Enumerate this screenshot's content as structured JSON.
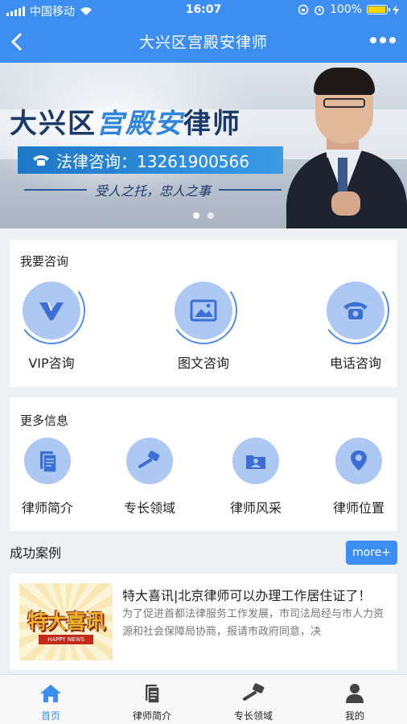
{
  "status_bar": {
    "carrier": "中国移动",
    "time": "16:07",
    "battery": "100%",
    "battery_level": 1.0
  },
  "header": {
    "title": "大兴区宫殿安律师",
    "back_icon": "back-arrow-icon",
    "more_icon": "more-dots-icon"
  },
  "banner": {
    "title_part1": "大兴区",
    "title_part2": "宫殿安",
    "title_part3": "律师",
    "phone_label": "法律咨询：13261900566",
    "motto": "受人之托，忠人之事",
    "slides": 2,
    "active_slide": 1
  },
  "consult": {
    "heading": "我要咨询",
    "items": [
      {
        "label": "VIP咨询",
        "icon": "vip-icon"
      },
      {
        "label": "图文咨询",
        "icon": "image-icon"
      },
      {
        "label": "电话咨询",
        "icon": "phone-icon"
      }
    ]
  },
  "more_info": {
    "heading": "更多信息",
    "items": [
      {
        "label": "律师简介",
        "icon": "document-icon"
      },
      {
        "label": "专长领域",
        "icon": "gavel-icon"
      },
      {
        "label": "律师风采",
        "icon": "photo-folder-icon"
      },
      {
        "label": "律师位置",
        "icon": "location-pin-icon"
      }
    ]
  },
  "cases": {
    "heading": "成功案例",
    "more_label": "more+",
    "items": [
      {
        "title": "特大喜讯|北京律师可以办理工作居住证了！",
        "desc": "为了促进首都法律服务工作发展，市司法局经与市人力资源和社会保障局协商，报请市政府同意，决",
        "thumb_text": "特大喜讯",
        "thumb_sub": "HAPPY NEWS"
      }
    ]
  },
  "tabbar": {
    "items": [
      {
        "label": "首页",
        "icon": "home-icon",
        "active": true
      },
      {
        "label": "律师简介",
        "icon": "document-icon",
        "active": false
      },
      {
        "label": "专长领域",
        "icon": "gavel-icon",
        "active": false
      },
      {
        "label": "我的",
        "icon": "user-icon",
        "active": false
      }
    ]
  },
  "colors": {
    "primary": "#3c8ff0",
    "icon_bg": "#adc8f3",
    "icon_fg": "#3b6fd3"
  }
}
